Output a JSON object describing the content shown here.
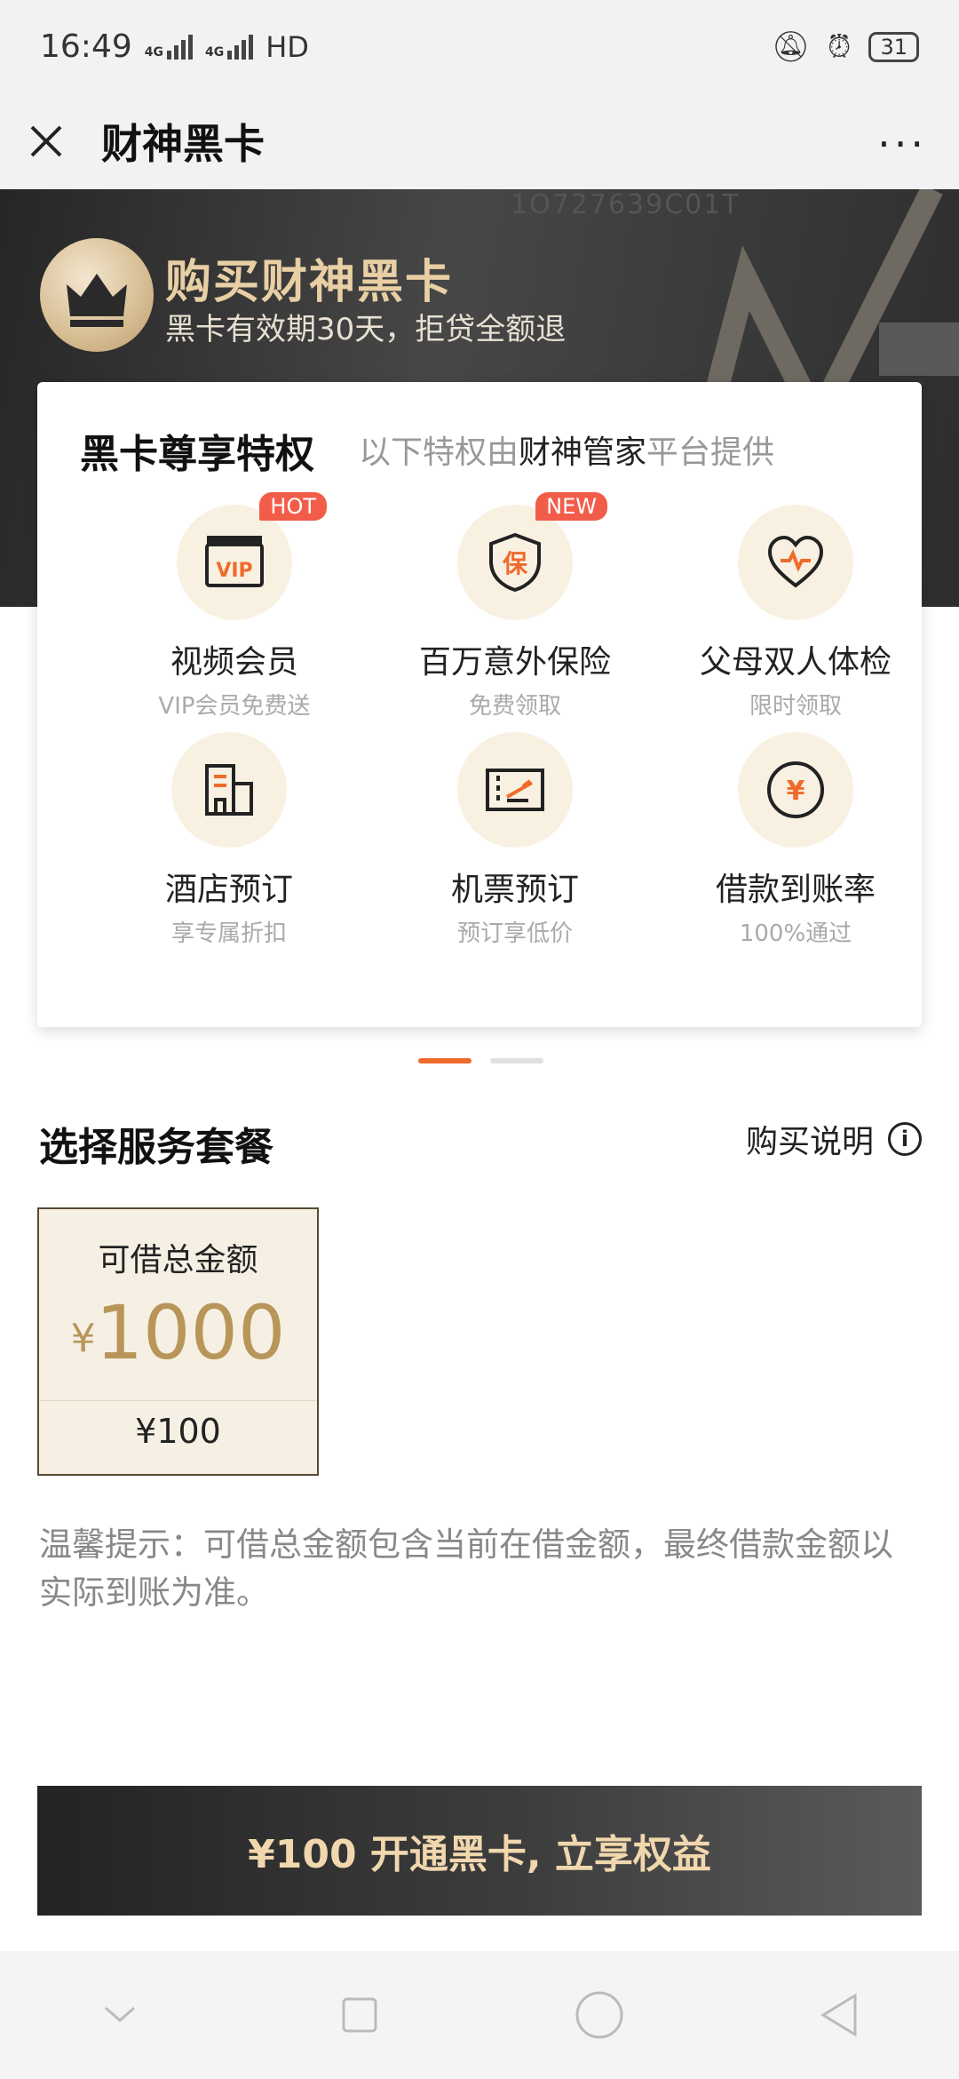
{
  "status_bar": {
    "time": "16:49",
    "network1": "4G",
    "network2": "4G",
    "hd": "HD",
    "battery": "31"
  },
  "titlebar": {
    "title": "财神黑卡",
    "more": "···"
  },
  "hero": {
    "title": "购买财神黑卡",
    "subtitle": "黑卡有效期30天，拒贷全额退",
    "watermark": "1O727639C01T"
  },
  "card": {
    "title": "黑卡尊享特权",
    "note_prefix": "以下特权由",
    "note_highlight": "财神管家",
    "note_suffix": "平台提供",
    "features": [
      {
        "name": "视频会员",
        "desc": "VIP会员免费送",
        "tag": "HOT",
        "icon": "vip-ticket-icon"
      },
      {
        "name": "百万意外保险",
        "desc": "免费领取",
        "tag": "NEW",
        "icon": "shield-bao-icon"
      },
      {
        "name": "父母双人体检",
        "desc": "限时领取",
        "tag": "",
        "icon": "heart-stethoscope-icon"
      },
      {
        "name": "酒店预订",
        "desc": "享专属折扣",
        "tag": "",
        "icon": "hotel-building-icon"
      },
      {
        "name": "机票预订",
        "desc": "预订享低价",
        "tag": "",
        "icon": "flight-ticket-icon"
      },
      {
        "name": "借款到账率",
        "desc": "100%通过",
        "tag": "",
        "icon": "yen-coin-icon"
      }
    ]
  },
  "section": {
    "title": "选择服务套餐",
    "buy_note": "购买说明"
  },
  "package": {
    "label": "可借总金额",
    "currency": "¥",
    "amount": "1000",
    "price": "¥100"
  },
  "tip": "温馨提示：可借总金额包含当前在借金额，最终借款金额以实际到账为准。",
  "cta": "¥100 开通黑卡, 立享权益",
  "colors": {
    "accent": "#ef6b2c",
    "gold": "#b8965a",
    "tag_red": "#f25d4a"
  }
}
